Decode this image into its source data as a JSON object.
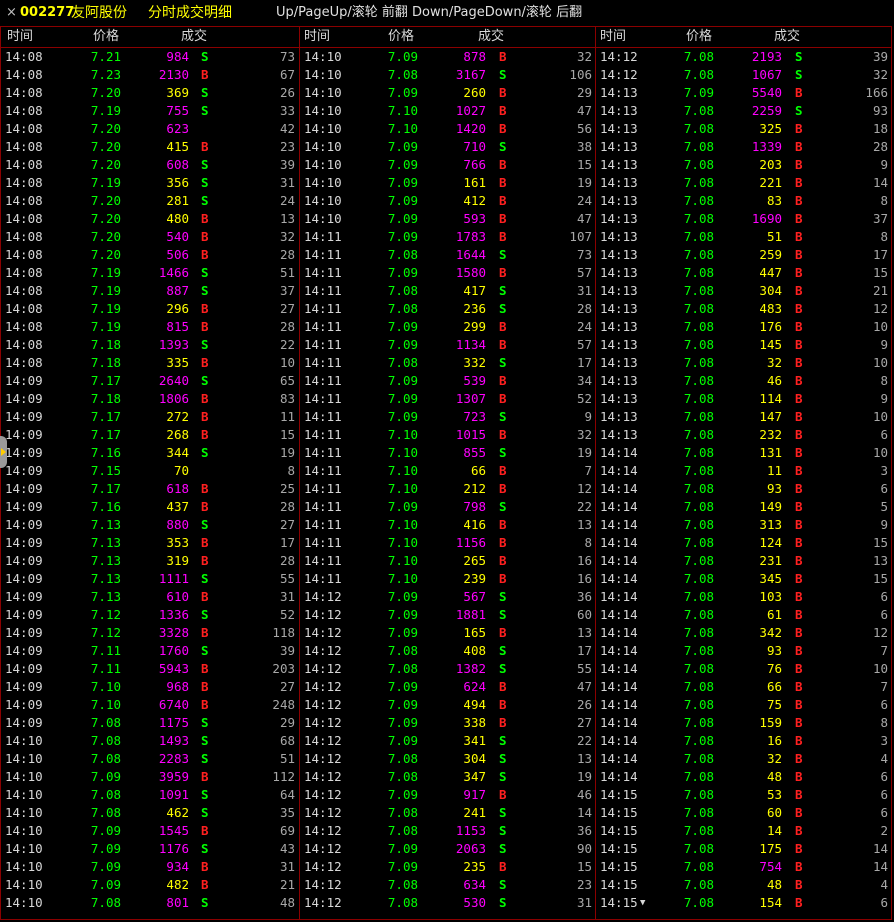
{
  "window": {
    "close_glyph": "×",
    "stock_code": "002277",
    "stock_name": "友阿股份",
    "subtitle": "分时成交明细",
    "hint": "Up/PageUp/滚轮 前翻 Down/PageDown/滚轮 后翻"
  },
  "headers": {
    "time": "时间",
    "price": "价格",
    "volume": "成交"
  },
  "colors": {
    "background": "#000000",
    "border": "#8b0000",
    "price": "#00ff00",
    "large_volume": "#ff00ff",
    "small_volume": "#ffff00",
    "buy": "#ff2020",
    "sell": "#00ff00",
    "text": "#d8d8d8"
  },
  "icons": {
    "close": "close-icon",
    "row_arrow": "triangle-down-icon",
    "scroll_handle": "scroll-handle-icon"
  },
  "columns": [
    {
      "rows": [
        [
          "14:08",
          "7.21",
          "984",
          "S",
          "73"
        ],
        [
          "14:08",
          "7.23",
          "2130",
          "B",
          "67"
        ],
        [
          "14:08",
          "7.20",
          "369",
          "S",
          "26"
        ],
        [
          "14:08",
          "7.19",
          "755",
          "S",
          "33"
        ],
        [
          "14:08",
          "7.20",
          "623",
          "",
          "42"
        ],
        [
          "14:08",
          "7.20",
          "415",
          "B",
          "23"
        ],
        [
          "14:08",
          "7.20",
          "608",
          "S",
          "39"
        ],
        [
          "14:08",
          "7.19",
          "356",
          "S",
          "31"
        ],
        [
          "14:08",
          "7.20",
          "281",
          "S",
          "24"
        ],
        [
          "14:08",
          "7.20",
          "480",
          "B",
          "13"
        ],
        [
          "14:08",
          "7.20",
          "540",
          "B",
          "32"
        ],
        [
          "14:08",
          "7.20",
          "506",
          "B",
          "28"
        ],
        [
          "14:08",
          "7.19",
          "1466",
          "S",
          "51"
        ],
        [
          "14:08",
          "7.19",
          "887",
          "S",
          "37"
        ],
        [
          "14:08",
          "7.19",
          "296",
          "B",
          "27"
        ],
        [
          "14:08",
          "7.19",
          "815",
          "B",
          "28"
        ],
        [
          "14:08",
          "7.18",
          "1393",
          "S",
          "22"
        ],
        [
          "14:08",
          "7.18",
          "335",
          "B",
          "10"
        ],
        [
          "14:09",
          "7.17",
          "2640",
          "S",
          "65"
        ],
        [
          "14:09",
          "7.18",
          "1806",
          "B",
          "83"
        ],
        [
          "14:09",
          "7.17",
          "272",
          "B",
          "11"
        ],
        [
          "14:09",
          "7.17",
          "268",
          "B",
          "15"
        ],
        [
          "14:09",
          "7.16",
          "344",
          "S",
          "19"
        ],
        [
          "14:09",
          "7.15",
          "70",
          "",
          "8"
        ],
        [
          "14:09",
          "7.17",
          "618",
          "B",
          "25"
        ],
        [
          "14:09",
          "7.16",
          "437",
          "B",
          "28"
        ],
        [
          "14:09",
          "7.13",
          "880",
          "S",
          "27"
        ],
        [
          "14:09",
          "7.13",
          "353",
          "B",
          "17"
        ],
        [
          "14:09",
          "7.13",
          "319",
          "B",
          "28"
        ],
        [
          "14:09",
          "7.13",
          "1111",
          "S",
          "55"
        ],
        [
          "14:09",
          "7.13",
          "610",
          "B",
          "31"
        ],
        [
          "14:09",
          "7.12",
          "1336",
          "S",
          "52"
        ],
        [
          "14:09",
          "7.12",
          "3328",
          "B",
          "118"
        ],
        [
          "14:09",
          "7.11",
          "1760",
          "S",
          "39"
        ],
        [
          "14:09",
          "7.11",
          "5943",
          "B",
          "203"
        ],
        [
          "14:09",
          "7.10",
          "968",
          "B",
          "27"
        ],
        [
          "14:09",
          "7.10",
          "6740",
          "B",
          "248"
        ],
        [
          "14:09",
          "7.08",
          "1175",
          "S",
          "29"
        ],
        [
          "14:10",
          "7.08",
          "1493",
          "S",
          "68"
        ],
        [
          "14:10",
          "7.08",
          "2283",
          "S",
          "51"
        ],
        [
          "14:10",
          "7.09",
          "3959",
          "B",
          "112"
        ],
        [
          "14:10",
          "7.08",
          "1091",
          "S",
          "64"
        ],
        [
          "14:10",
          "7.08",
          "462",
          "S",
          "35"
        ],
        [
          "14:10",
          "7.09",
          "1545",
          "B",
          "69"
        ],
        [
          "14:10",
          "7.09",
          "1176",
          "S",
          "43"
        ],
        [
          "14:10",
          "7.09",
          "934",
          "B",
          "31"
        ],
        [
          "14:10",
          "7.09",
          "482",
          "B",
          "21"
        ],
        [
          "14:10",
          "7.08",
          "801",
          "S",
          "48"
        ]
      ]
    },
    {
      "rows": [
        [
          "14:10",
          "7.09",
          "878",
          "B",
          "32"
        ],
        [
          "14:10",
          "7.08",
          "3167",
          "S",
          "106"
        ],
        [
          "14:10",
          "7.09",
          "260",
          "B",
          "29"
        ],
        [
          "14:10",
          "7.10",
          "1027",
          "B",
          "47"
        ],
        [
          "14:10",
          "7.10",
          "1420",
          "B",
          "56"
        ],
        [
          "14:10",
          "7.09",
          "710",
          "S",
          "38"
        ],
        [
          "14:10",
          "7.09",
          "766",
          "B",
          "15"
        ],
        [
          "14:10",
          "7.09",
          "161",
          "B",
          "19"
        ],
        [
          "14:10",
          "7.09",
          "412",
          "B",
          "24"
        ],
        [
          "14:10",
          "7.09",
          "593",
          "B",
          "47"
        ],
        [
          "14:11",
          "7.09",
          "1783",
          "B",
          "107"
        ],
        [
          "14:11",
          "7.08",
          "1644",
          "S",
          "73"
        ],
        [
          "14:11",
          "7.09",
          "1580",
          "B",
          "57"
        ],
        [
          "14:11",
          "7.08",
          "417",
          "S",
          "31"
        ],
        [
          "14:11",
          "7.08",
          "236",
          "S",
          "28"
        ],
        [
          "14:11",
          "7.09",
          "299",
          "B",
          "24"
        ],
        [
          "14:11",
          "7.09",
          "1134",
          "B",
          "57"
        ],
        [
          "14:11",
          "7.08",
          "332",
          "S",
          "17"
        ],
        [
          "14:11",
          "7.09",
          "539",
          "B",
          "34"
        ],
        [
          "14:11",
          "7.09",
          "1307",
          "B",
          "52"
        ],
        [
          "14:11",
          "7.09",
          "723",
          "S",
          "9"
        ],
        [
          "14:11",
          "7.10",
          "1015",
          "B",
          "32"
        ],
        [
          "14:11",
          "7.10",
          "855",
          "S",
          "19"
        ],
        [
          "14:11",
          "7.10",
          "66",
          "B",
          "7"
        ],
        [
          "14:11",
          "7.10",
          "212",
          "B",
          "12"
        ],
        [
          "14:11",
          "7.09",
          "798",
          "S",
          "22"
        ],
        [
          "14:11",
          "7.10",
          "416",
          "B",
          "13"
        ],
        [
          "14:11",
          "7.10",
          "1156",
          "B",
          "8"
        ],
        [
          "14:11",
          "7.10",
          "265",
          "B",
          "16"
        ],
        [
          "14:11",
          "7.10",
          "239",
          "B",
          "16"
        ],
        [
          "14:12",
          "7.09",
          "567",
          "S",
          "36"
        ],
        [
          "14:12",
          "7.09",
          "1881",
          "S",
          "60"
        ],
        [
          "14:12",
          "7.09",
          "165",
          "B",
          "13"
        ],
        [
          "14:12",
          "7.08",
          "408",
          "S",
          "17"
        ],
        [
          "14:12",
          "7.08",
          "1382",
          "S",
          "55"
        ],
        [
          "14:12",
          "7.09",
          "624",
          "B",
          "47"
        ],
        [
          "14:12",
          "7.09",
          "494",
          "B",
          "26"
        ],
        [
          "14:12",
          "7.09",
          "338",
          "B",
          "27"
        ],
        [
          "14:12",
          "7.09",
          "341",
          "S",
          "22"
        ],
        [
          "14:12",
          "7.08",
          "304",
          "S",
          "13"
        ],
        [
          "14:12",
          "7.08",
          "347",
          "S",
          "19"
        ],
        [
          "14:12",
          "7.09",
          "917",
          "B",
          "46"
        ],
        [
          "14:12",
          "7.08",
          "241",
          "S",
          "14"
        ],
        [
          "14:12",
          "7.08",
          "1153",
          "S",
          "36"
        ],
        [
          "14:12",
          "7.09",
          "2063",
          "S",
          "90"
        ],
        [
          "14:12",
          "7.09",
          "235",
          "B",
          "15"
        ],
        [
          "14:12",
          "7.08",
          "634",
          "S",
          "23"
        ],
        [
          "14:12",
          "7.08",
          "530",
          "S",
          "31"
        ]
      ]
    },
    {
      "rows": [
        [
          "14:12",
          "7.08",
          "2193",
          "S",
          "39"
        ],
        [
          "14:12",
          "7.08",
          "1067",
          "S",
          "32"
        ],
        [
          "14:13",
          "7.09",
          "5540",
          "B",
          "166"
        ],
        [
          "14:13",
          "7.08",
          "2259",
          "S",
          "93"
        ],
        [
          "14:13",
          "7.08",
          "325",
          "B",
          "18"
        ],
        [
          "14:13",
          "7.08",
          "1339",
          "B",
          "28"
        ],
        [
          "14:13",
          "7.08",
          "203",
          "B",
          "9"
        ],
        [
          "14:13",
          "7.08",
          "221",
          "B",
          "14"
        ],
        [
          "14:13",
          "7.08",
          "83",
          "B",
          "8"
        ],
        [
          "14:13",
          "7.08",
          "1690",
          "B",
          "37"
        ],
        [
          "14:13",
          "7.08",
          "51",
          "B",
          "8"
        ],
        [
          "14:13",
          "7.08",
          "259",
          "B",
          "17"
        ],
        [
          "14:13",
          "7.08",
          "447",
          "B",
          "15"
        ],
        [
          "14:13",
          "7.08",
          "304",
          "B",
          "21"
        ],
        [
          "14:13",
          "7.08",
          "483",
          "B",
          "12"
        ],
        [
          "14:13",
          "7.08",
          "176",
          "B",
          "10"
        ],
        [
          "14:13",
          "7.08",
          "145",
          "B",
          "9"
        ],
        [
          "14:13",
          "7.08",
          "32",
          "B",
          "10"
        ],
        [
          "14:13",
          "7.08",
          "46",
          "B",
          "8"
        ],
        [
          "14:13",
          "7.08",
          "114",
          "B",
          "9"
        ],
        [
          "14:13",
          "7.08",
          "147",
          "B",
          "10"
        ],
        [
          "14:13",
          "7.08",
          "232",
          "B",
          "6"
        ],
        [
          "14:14",
          "7.08",
          "131",
          "B",
          "10"
        ],
        [
          "14:14",
          "7.08",
          "11",
          "B",
          "3"
        ],
        [
          "14:14",
          "7.08",
          "93",
          "B",
          "6"
        ],
        [
          "14:14",
          "7.08",
          "149",
          "B",
          "5"
        ],
        [
          "14:14",
          "7.08",
          "313",
          "B",
          "9"
        ],
        [
          "14:14",
          "7.08",
          "124",
          "B",
          "15"
        ],
        [
          "14:14",
          "7.08",
          "231",
          "B",
          "13"
        ],
        [
          "14:14",
          "7.08",
          "345",
          "B",
          "15"
        ],
        [
          "14:14",
          "7.08",
          "103",
          "B",
          "6"
        ],
        [
          "14:14",
          "7.08",
          "61",
          "B",
          "6"
        ],
        [
          "14:14",
          "7.08",
          "342",
          "B",
          "12"
        ],
        [
          "14:14",
          "7.08",
          "93",
          "B",
          "7"
        ],
        [
          "14:14",
          "7.08",
          "76",
          "B",
          "10"
        ],
        [
          "14:14",
          "7.08",
          "66",
          "B",
          "7"
        ],
        [
          "14:14",
          "7.08",
          "75",
          "B",
          "6"
        ],
        [
          "14:14",
          "7.08",
          "159",
          "B",
          "8"
        ],
        [
          "14:14",
          "7.08",
          "16",
          "B",
          "3"
        ],
        [
          "14:14",
          "7.08",
          "32",
          "B",
          "4"
        ],
        [
          "14:14",
          "7.08",
          "48",
          "B",
          "6"
        ],
        [
          "14:15",
          "7.08",
          "53",
          "B",
          "6"
        ],
        [
          "14:15",
          "7.08",
          "60",
          "B",
          "6"
        ],
        [
          "14:15",
          "7.08",
          "14",
          "B",
          "2"
        ],
        [
          "14:15",
          "7.08",
          "175",
          "B",
          "14"
        ],
        [
          "14:15",
          "7.08",
          "754",
          "B",
          "14"
        ],
        [
          "14:15",
          "7.08",
          "48",
          "B",
          "4"
        ],
        [
          "14:15",
          "7.08",
          "154",
          "B",
          "6"
        ]
      ]
    }
  ]
}
